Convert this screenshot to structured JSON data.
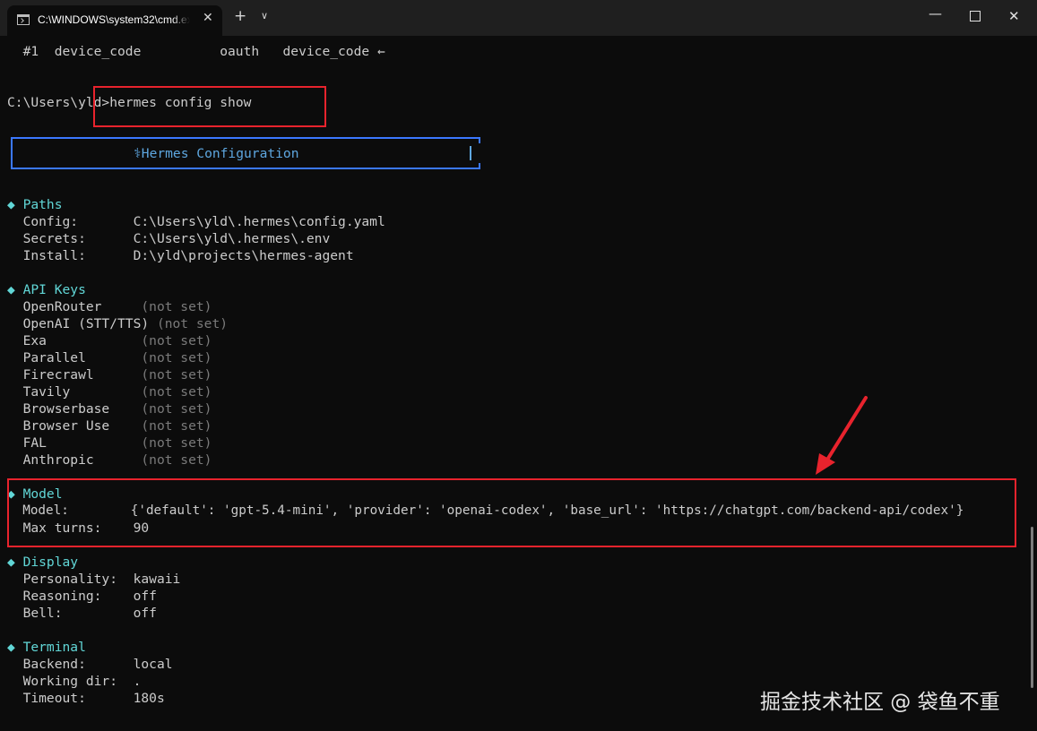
{
  "window": {
    "tab_title": "C:\\WINDOWS\\system32\\cmd.exe",
    "tab_icon": "cmd-icon",
    "close_glyph": "✕",
    "new_tab_glyph": "+",
    "dropdown_glyph": "∨",
    "minimize_glyph": "—",
    "close_window_glyph": "✕"
  },
  "terminal": {
    "top_line": "  #1  device_code          oauth   device_code ←",
    "prompt": "C:\\Users\\yld>",
    "command": "hermes config show",
    "header_title": "⚕Hermes Configuration",
    "sections": {
      "paths": {
        "title": "◆ Paths",
        "rows": [
          {
            "key": "  Config:       ",
            "value": "C:\\Users\\yld\\.hermes\\config.yaml"
          },
          {
            "key": "  Secrets:      ",
            "value": "C:\\Users\\yld\\.hermes\\.env"
          },
          {
            "key": "  Install:      ",
            "value": "D:\\yld\\projects\\hermes-agent"
          }
        ]
      },
      "api_keys": {
        "title": "◆ API Keys",
        "rows": [
          {
            "key": "  OpenRouter     ",
            "value": "(not set)"
          },
          {
            "key": "  OpenAI (STT/TTS) ",
            "value": "(not set)"
          },
          {
            "key": "  Exa            ",
            "value": "(not set)"
          },
          {
            "key": "  Parallel       ",
            "value": "(not set)"
          },
          {
            "key": "  Firecrawl      ",
            "value": "(not set)"
          },
          {
            "key": "  Tavily         ",
            "value": "(not set)"
          },
          {
            "key": "  Browserbase    ",
            "value": "(not set)"
          },
          {
            "key": "  Browser Use    ",
            "value": "(not set)"
          },
          {
            "key": "  FAL            ",
            "value": "(not set)"
          },
          {
            "key": "  Anthropic      ",
            "value": "(not set)"
          }
        ]
      },
      "model": {
        "title": "◆ Model",
        "rows": [
          {
            "key": "  Model:        ",
            "value": "{'default': 'gpt-5.4-mini', 'provider': 'openai-codex', 'base_url': 'https://chatgpt.com/backend-api/codex'}"
          },
          {
            "key": "  Max turns:    ",
            "value": "90"
          }
        ]
      },
      "display": {
        "title": "◆ Display",
        "rows": [
          {
            "key": "  Personality:  ",
            "value": "kawaii"
          },
          {
            "key": "  Reasoning:    ",
            "value": "off"
          },
          {
            "key": "  Bell:         ",
            "value": "off"
          }
        ]
      },
      "terminal": {
        "title": "◆ Terminal",
        "rows": [
          {
            "key": "  Backend:      ",
            "value": "local"
          },
          {
            "key": "  Working dir:  ",
            "value": "."
          },
          {
            "key": "  Timeout:      ",
            "value": "180s"
          }
        ]
      }
    }
  },
  "annotations": {
    "color": "#e8232d",
    "arrow": "red-arrow"
  },
  "watermark": "掘金技术社区 @ 袋鱼不重"
}
